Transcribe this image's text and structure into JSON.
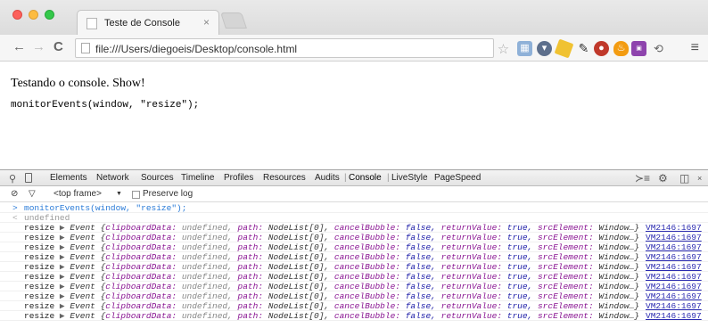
{
  "browser": {
    "tab_title": "Teste de Console",
    "tab_close": "×",
    "url": "file:///Users/diegoeis/Desktop/console.html",
    "menu_icon": "hamburger-menu-icon"
  },
  "page": {
    "heading": "Testando o console. Show!",
    "code": "monitorEvents(window, \"resize\");"
  },
  "devtools": {
    "tabs": [
      "Elements",
      "Network",
      "Sources",
      "Timeline",
      "Profiles",
      "Resources",
      "Audits",
      "Console",
      "LiveStyle",
      "PageSpeed"
    ],
    "active_tab": "Console",
    "filter": {
      "frame": "<top frame>",
      "frame_arrow": "▼",
      "preserve_log": "Preserve log"
    },
    "console": {
      "input": "monitorEvents(window, \"resize\");",
      "result": "undefined",
      "event_label": "resize",
      "event_tri": "▶",
      "event_type": "Event",
      "fields": {
        "clipboardData_key": "clipboardData:",
        "clipboardData_val": "undefined,",
        "path_key": "path:",
        "path_val": "NodeList[0],",
        "cancelBubble_key": "cancelBubble:",
        "cancelBubble_val": "false,",
        "returnValue_key": "returnValue:",
        "returnValue_val": "true,",
        "srcElement_key": "srcElement:",
        "srcElement_val": "Window…}"
      },
      "source_link": "VM2146:1697",
      "event_count": 10
    }
  }
}
